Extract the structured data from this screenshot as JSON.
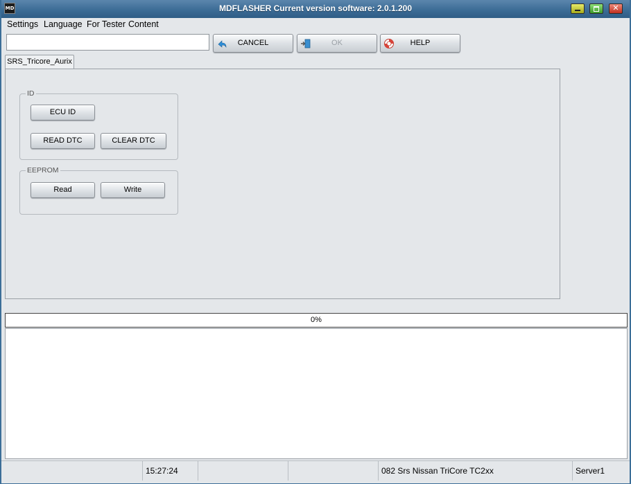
{
  "titlebar": {
    "title": "MDFLASHER  Current version software: 2.0.1.200",
    "icon_text": "MD",
    "close_glyph": "✕"
  },
  "menu": {
    "items": [
      "Settings",
      "Language",
      "For Tester",
      "Content"
    ]
  },
  "toolbar": {
    "input_value": "",
    "cancel_label": "CANCEL",
    "ok_label": "OK",
    "help_label": "HELP"
  },
  "tabs": [
    {
      "label": "SRS_Tricore_Aurix",
      "active": true
    }
  ],
  "groups": {
    "id": {
      "label": "ID",
      "ecu_id_label": "ECU ID",
      "read_dtc_label": "READ DTC",
      "clear_dtc_label": "CLEAR DTC"
    },
    "eeprom": {
      "label": "EEPROM",
      "read_label": "Read",
      "write_label": "Write"
    }
  },
  "progress": {
    "text": "0%",
    "value": 0
  },
  "log": {
    "text": ""
  },
  "statusbar": {
    "cells": [
      "",
      "15:27:24",
      "",
      "",
      "082 Srs Nissan TriCore TC2xx",
      "Server1"
    ]
  },
  "colors": {
    "titlebar": "#3a6a94",
    "window_bg": "#e4e7ea",
    "progress_fill": "#3c8dd8"
  },
  "icons": {
    "cancel": "undo-arrow-icon",
    "ok": "enter-door-icon",
    "help": "lifebuoy-icon"
  }
}
